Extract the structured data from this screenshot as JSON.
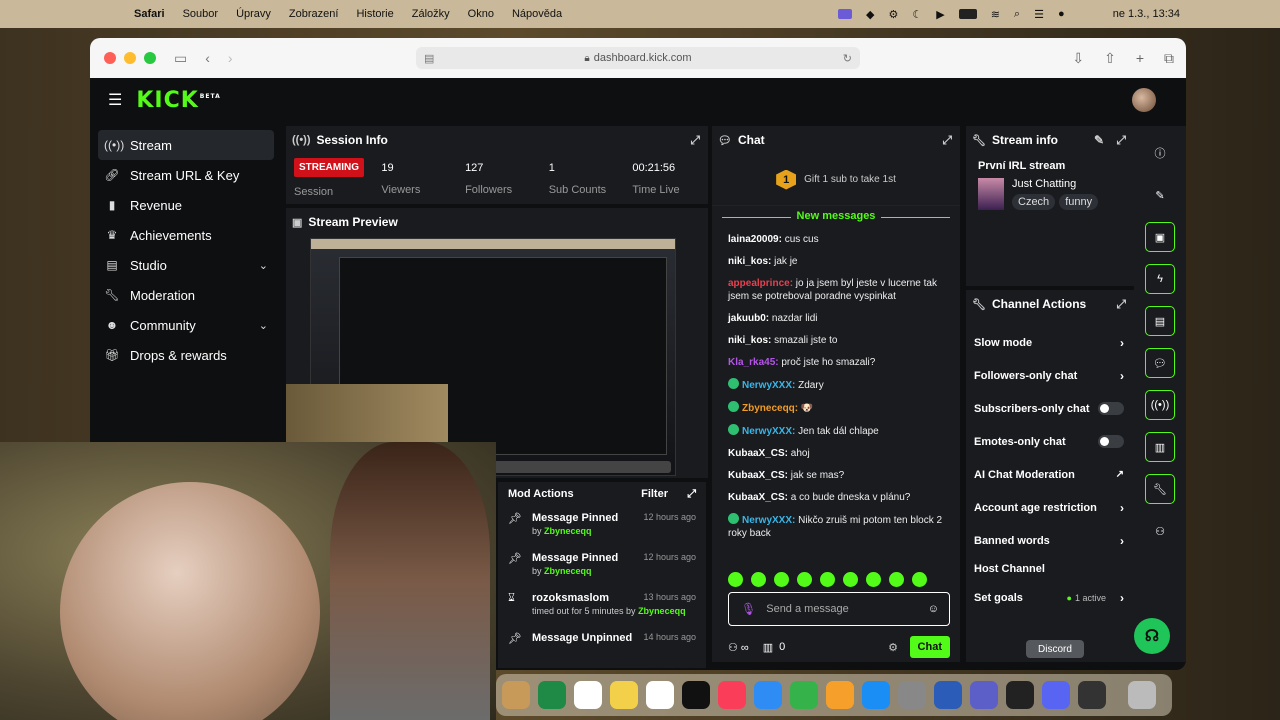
{
  "menubar": {
    "app": "Safari",
    "items": [
      "Soubor",
      "Úpravy",
      "Zobrazení",
      "Historie",
      "Záložky",
      "Okno",
      "Nápověda"
    ],
    "clock": "ne 1.3., 13:34"
  },
  "browser": {
    "url": "dashboard.kick.com"
  },
  "site": {
    "logo": "KICK",
    "logo_badge": "BETA"
  },
  "sidebar": {
    "items": [
      {
        "label": "Stream",
        "icon": "stream-icon"
      },
      {
        "label": "Stream URL & Key",
        "icon": "link-icon"
      },
      {
        "label": "Revenue",
        "icon": "chart-icon"
      },
      {
        "label": "Achievements",
        "icon": "trophy-icon"
      },
      {
        "label": "Studio",
        "icon": "studio-icon"
      },
      {
        "label": "Moderation",
        "icon": "wrench-icon"
      },
      {
        "label": "Community",
        "icon": "people-icon"
      },
      {
        "label": "Drops & rewards",
        "icon": "gift-icon"
      }
    ]
  },
  "session": {
    "title": "Session Info",
    "status": "STREAMING",
    "status_label": "Session",
    "stats": [
      {
        "value": "19",
        "label": "Viewers"
      },
      {
        "value": "127",
        "label": "Followers"
      },
      {
        "value": "1",
        "label": "Sub Counts"
      },
      {
        "value": "00:21:56",
        "label": "Time Live"
      }
    ]
  },
  "preview": {
    "title": "Stream Preview"
  },
  "chat": {
    "title": "Chat",
    "gift_count": "1",
    "gift_text": "Gift 1 sub to take 1st",
    "new_messages": "New messages",
    "messages": [
      {
        "user": "laina20009:",
        "text": " cus cus",
        "color": "#ffffff",
        "verified": false
      },
      {
        "user": "niki_kos:",
        "text": " jak je",
        "color": "#ffffff",
        "verified": false
      },
      {
        "user": "appealprince:",
        "text": " jo ja jsem byl jeste v lucerne tak jsem se potreboval poradne vyspinkat",
        "color": "#e8414f",
        "verified": false
      },
      {
        "user": "jakuub0:",
        "text": " nazdar lidi",
        "color": "#ffffff",
        "verified": false
      },
      {
        "user": "niki_kos:",
        "text": " smazali jste to",
        "color": "#ffffff",
        "verified": false
      },
      {
        "user": "Kla_rka45:",
        "text": " proč jste ho smazali?",
        "color": "#b455e8",
        "verified": false
      },
      {
        "user": "NerwyXXX:",
        "text": " Zdary",
        "color": "#39b6e8",
        "verified": true
      },
      {
        "user": "Zbyneceqq:",
        "text": " 🐶",
        "color": "#f39c25",
        "verified": true
      },
      {
        "user": "NerwyXXX:",
        "text": " Jen tak dál chlape",
        "color": "#39b6e8",
        "verified": true
      },
      {
        "user": "KubaaX_CS:",
        "text": " ahoj",
        "color": "#ffffff",
        "verified": false
      },
      {
        "user": "KubaaX_CS:",
        "text": " jak se mas?",
        "color": "#ffffff",
        "verified": false
      },
      {
        "user": "KubaaX_CS:",
        "text": " a co bude dneska v plánu?",
        "color": "#ffffff",
        "verified": false
      },
      {
        "user": "NerwyXXX:",
        "text": " Nikčo zruiš mi potom ten block 2 roky back",
        "color": "#39b6e8",
        "verified": true
      }
    ],
    "input_placeholder": "Send a message",
    "viewer_count": "0",
    "send_label": "Chat"
  },
  "stream_info": {
    "title": "Stream info",
    "stream_title": "První IRL stream",
    "category": "Just Chatting",
    "tags": [
      "Czech",
      "funny"
    ]
  },
  "channel_actions": {
    "title": "Channel Actions",
    "items": [
      {
        "label": "Slow mode",
        "control": "chevron"
      },
      {
        "label": "Followers-only chat",
        "control": "chevron"
      },
      {
        "label": "Subscribers-only chat",
        "control": "toggle"
      },
      {
        "label": "Emotes-only chat",
        "control": "toggle"
      },
      {
        "label": "AI Chat Moderation",
        "control": "external"
      },
      {
        "label": "Account age restriction",
        "control": "chevron"
      },
      {
        "label": "Banned words",
        "control": "chevron"
      },
      {
        "label": "Host Channel",
        "control": "none"
      },
      {
        "label": "Set goals",
        "control": "chevron",
        "note": "1 active"
      }
    ]
  },
  "mod_actions": {
    "title": "Mod Actions",
    "filter": "Filter",
    "items": [
      {
        "title": "Message Pinned",
        "by_prefix": "by ",
        "by": "Zbyneceqq",
        "time": "12 hours ago",
        "icon": "pin-icon"
      },
      {
        "title": "Message Pinned",
        "by_prefix": "by ",
        "by": "Zbyneceqq",
        "time": "12 hours ago",
        "icon": "pin-icon"
      },
      {
        "title": "rozoksmaslom",
        "by_prefix": "timed out for 5 minutes by ",
        "by": "Zbyneceqq",
        "time": "13 hours ago",
        "icon": "hourglass-icon"
      },
      {
        "title": "Message Unpinned",
        "by_prefix": "",
        "by": "",
        "time": "14 hours ago",
        "icon": "pin-icon"
      }
    ]
  },
  "tooltip": "Discord",
  "colors": {
    "accent": "#53fc18",
    "live": "#d1111a",
    "panel": "#191b1f",
    "background": "#0e0f10"
  }
}
